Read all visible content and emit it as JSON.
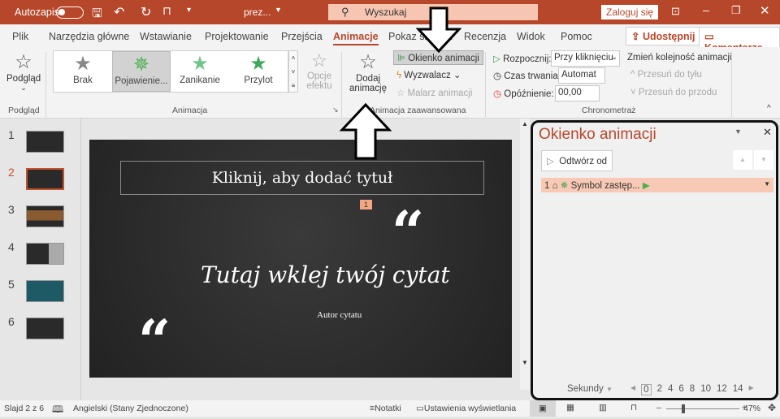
{
  "titlebar": {
    "autosave": "Autozapis",
    "filename": "prez...",
    "search_placeholder": "Wyszukaj",
    "signin": "Zaloguj się"
  },
  "tabs": [
    "Plik",
    "Narzędzia główne",
    "Wstawianie",
    "Projektowanie",
    "Przejścia",
    "Animacje",
    "Pokaz slajdów",
    "Recenzja",
    "Widok",
    "Pomoc"
  ],
  "share": "Udostępnij",
  "comments": "Komentarze",
  "ribbon": {
    "preview": "Podgląd",
    "preview_group": "Podgląd",
    "gallery": [
      "Brak",
      "Pojawienie...",
      "Zanikanie",
      "Przylot"
    ],
    "effect_options_1": "Opcje",
    "effect_options_2": "efektu",
    "animation_group": "Animacja",
    "add_anim_1": "Dodaj",
    "add_anim_2": "animację",
    "anim_pane": "Okienko animacji",
    "trigger": "Wyzwalacz",
    "painter": "Malarz animacji",
    "advanced_group": "Animacja zaawansowana",
    "start_label": "Rozpocznij:",
    "start_value": "Przy kliknięciu",
    "duration_label": "Czas trwania:",
    "duration_value": "Automat",
    "delay_label": "Opóźnienie:",
    "delay_value": "00,00",
    "reorder": "Zmień kolejność animacji",
    "move_back": "Przesuń do tyłu",
    "move_forward": "Przesuń do przodu",
    "timing_group": "Chronometraż"
  },
  "slides": [
    "1",
    "2",
    "3",
    "4",
    "5",
    "6"
  ],
  "slide": {
    "title": "Kliknij, aby dodać tytuł",
    "tag": "1",
    "quote": "Tutaj wklej twój cytat",
    "author": "Autor cytatu",
    "quote_mark": "“"
  },
  "pane": {
    "title": "Okienko animacji",
    "play_from": "Odtwórz od",
    "item_num": "1",
    "item_label": "Symbol zastęp...",
    "seconds": "Sekundy",
    "ticks": [
      "0",
      "2",
      "4",
      "6",
      "8",
      "10",
      "12",
      "14"
    ]
  },
  "status": {
    "slide": "Slajd 2 z 6",
    "language": "Angielski (Stany Zjednoczone)",
    "notes": "Notatki",
    "display": "Ustawienia wyświetlania",
    "zoom": "47%",
    "zoom_fraction": 0.47
  },
  "colors": {
    "accent": "#b7472a",
    "selected_item": "#f8c9b4"
  }
}
